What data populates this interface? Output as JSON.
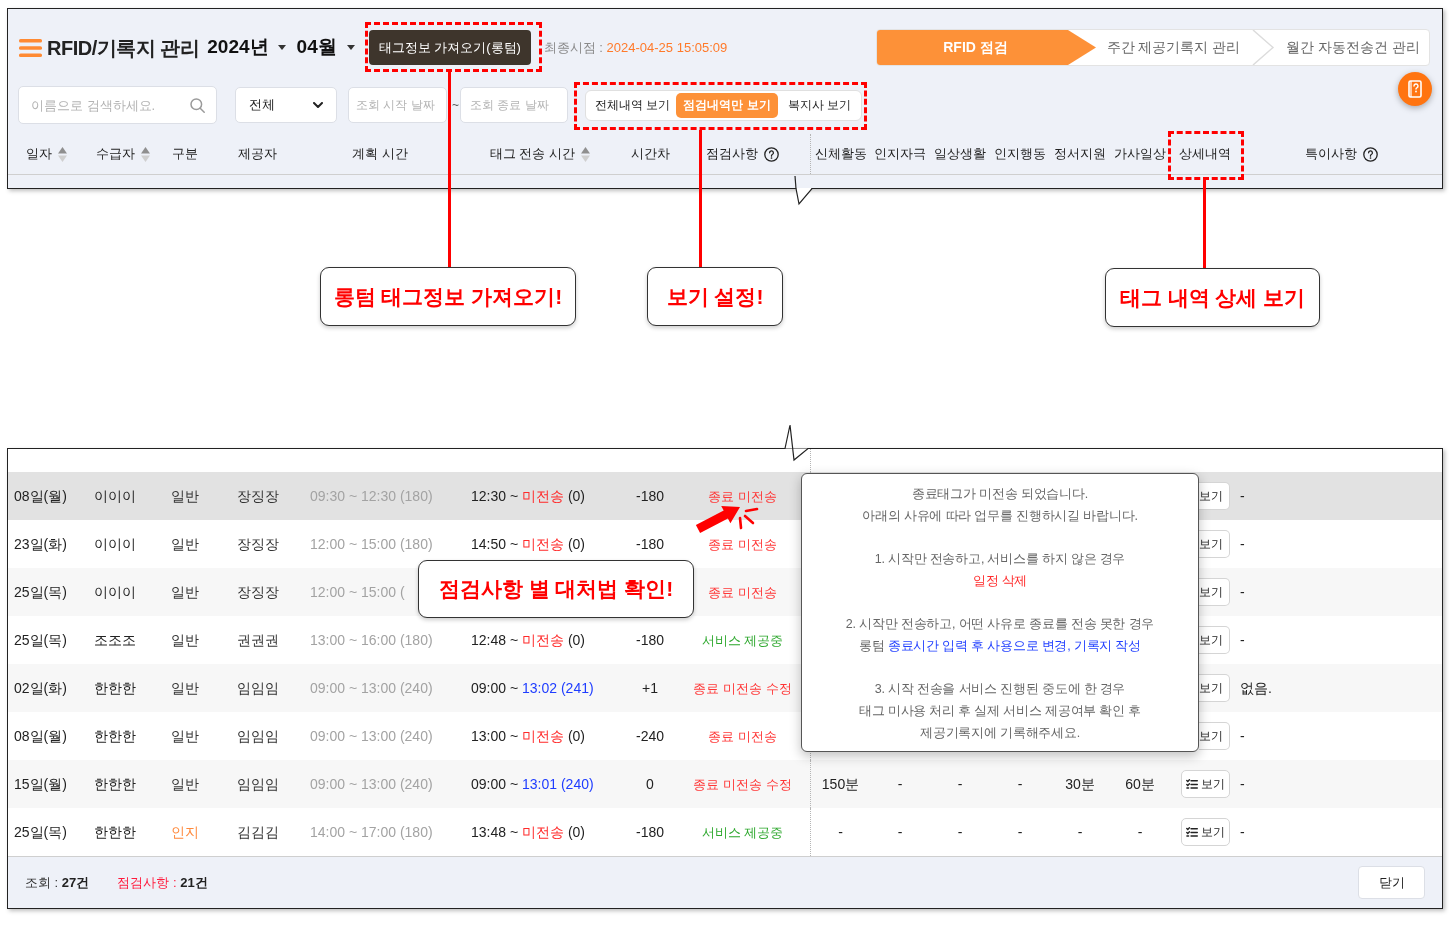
{
  "header": {
    "title": "RFID/기록지 관리",
    "year": "2024년",
    "month": "04월",
    "fetch_button": "태그정보 가져오기(롱텀)",
    "last_sync": {
      "label": "최종시점 :",
      "value": "2024-04-25 15:05:09"
    }
  },
  "steps": [
    {
      "label": "RFID 점검",
      "selected": true
    },
    {
      "label": "주간 제공기록지 관리",
      "selected": false
    },
    {
      "label": "월간 자동전송건 관리",
      "selected": false
    }
  ],
  "filters": {
    "search": {
      "placeholder": "이름으로 검색하세요."
    },
    "category": {
      "value": "전체"
    },
    "start_date": {
      "placeholder": "조회 시작 날짜"
    },
    "separator": "~",
    "end_date": {
      "placeholder": "조회 종료 날짜"
    }
  },
  "view_modes": [
    {
      "label": "전체내역 보기",
      "selected": false
    },
    {
      "label": "점검내역만 보기",
      "selected": true
    },
    {
      "label": "복지사 보기",
      "selected": false
    }
  ],
  "table": {
    "columns": [
      {
        "label": "일자",
        "kind": "sort"
      },
      {
        "label": "수급자",
        "kind": "sort"
      },
      {
        "label": "구분",
        "kind": "plain"
      },
      {
        "label": "제공자",
        "kind": "plain"
      },
      {
        "label": "계획 시간",
        "kind": "plain"
      },
      {
        "label": "태그 전송 시간",
        "kind": "sort"
      },
      {
        "label": "시간차",
        "kind": "plain"
      },
      {
        "label": "점검사항",
        "kind": "help"
      },
      {
        "label": "신체활동",
        "kind": "plain"
      },
      {
        "label": "인지자극",
        "kind": "plain"
      },
      {
        "label": "일상생활",
        "kind": "plain"
      },
      {
        "label": "인지행동",
        "kind": "plain"
      },
      {
        "label": "정서지원",
        "kind": "plain"
      },
      {
        "label": "가사일상",
        "kind": "plain"
      },
      {
        "label": "상세내역",
        "kind": "plain"
      },
      {
        "label": "특이사항",
        "kind": "help"
      }
    ],
    "rows": [
      {
        "date": "08일(월)",
        "recipient": "이이이",
        "category": {
          "label": "일반",
          "kind": "general"
        },
        "provider": "장징장",
        "planned": "09:30 ~ 12:30 (180)",
        "sent": {
          "start": "12:30 ~",
          "end": "미전송",
          "minutes": "(0)",
          "delivered": false
        },
        "diff": "-180",
        "check": {
          "label": "종료 미전송",
          "kind": "alert"
        },
        "detail": {
          "label": "보기",
          "clipped": true
        },
        "note": "-",
        "selected": true
      },
      {
        "date": "23일(화)",
        "recipient": "이이이",
        "category": {
          "label": "일반",
          "kind": "general"
        },
        "provider": "장징장",
        "planned": "12:00 ~ 15:00 (180)",
        "sent": {
          "start": "14:50 ~",
          "end": "미전송",
          "minutes": "(0)",
          "delivered": false
        },
        "diff": "-180",
        "check": {
          "label": "종료 미전송",
          "kind": "alert"
        },
        "detail": {
          "label": "보기",
          "clipped": true
        },
        "note": "-",
        "selected": false
      },
      {
        "date": "25일(목)",
        "recipient": "이이이",
        "category": {
          "label": "일반",
          "kind": "general"
        },
        "provider": "장징장",
        "planned": "12:00 ~ 15:00 (",
        "check": {
          "label": "종료 미전송",
          "kind": "alert"
        },
        "detail": {
          "label": "보기",
          "clipped": true
        },
        "note": "-",
        "selected": false
      },
      {
        "date": "25일(목)",
        "recipient": "조조조",
        "category": {
          "label": "일반",
          "kind": "general"
        },
        "provider": "권권권",
        "planned": "13:00 ~ 16:00 (180)",
        "sent": {
          "start": "12:48 ~",
          "end": "미전송",
          "minutes": "(0)",
          "delivered": false
        },
        "diff": "-180",
        "check": {
          "label": "서비스 제공중",
          "kind": "ok"
        },
        "detail": {
          "label": "보기",
          "clipped": true
        },
        "note": "-",
        "selected": false
      },
      {
        "date": "02일(화)",
        "recipient": "한한한",
        "category": {
          "label": "일반",
          "kind": "general"
        },
        "provider": "임임임",
        "planned": "09:00 ~ 13:00 (240)",
        "sent": {
          "start": "09:00 ~",
          "end": "13:02",
          "minutes": "(241)",
          "delivered": true
        },
        "diff": "+1",
        "check": {
          "label": "종료 미전송 수정",
          "kind": "alert"
        },
        "detail": {
          "label": "보기",
          "clipped": true
        },
        "note": "없음.",
        "selected": false
      },
      {
        "date": "08일(월)",
        "recipient": "한한한",
        "category": {
          "label": "일반",
          "kind": "general"
        },
        "provider": "임임임",
        "planned": "09:00 ~ 13:00 (240)",
        "sent": {
          "start": "13:00 ~",
          "end": "미전송",
          "minutes": "(0)",
          "delivered": false
        },
        "diff": "-240",
        "check": {
          "label": "종료 미전송",
          "kind": "alert"
        },
        "detail": {
          "label": "보기",
          "clipped": true
        },
        "note": "-",
        "selected": false
      },
      {
        "date": "15일(월)",
        "recipient": "한한한",
        "category": {
          "label": "일반",
          "kind": "general"
        },
        "provider": "임임임",
        "planned": "09:00 ~ 13:00 (240)",
        "sent": {
          "start": "09:00 ~",
          "end": "13:01",
          "minutes": "(240)",
          "delivered": true
        },
        "diff": "0",
        "check": {
          "label": "종료 미전송 수정",
          "kind": "alert"
        },
        "activities": [
          "150분",
          "-",
          "-",
          "-",
          "30분",
          "60분"
        ],
        "detail": {
          "label": "보기",
          "clipped": false
        },
        "note": "-",
        "selected": false
      },
      {
        "date": "25일(목)",
        "recipient": "한한한",
        "category": {
          "label": "인지",
          "kind": "cognitive"
        },
        "provider": "김김김",
        "planned": "14:00 ~ 17:00 (180)",
        "sent": {
          "start": "13:48 ~",
          "end": "미전송",
          "minutes": "(0)",
          "delivered": false
        },
        "diff": "-180",
        "check": {
          "label": "서비스 제공중",
          "kind": "ok"
        },
        "activities": [
          "-",
          "-",
          "-",
          "-",
          "-",
          "-"
        ],
        "detail": {
          "label": "보기",
          "clipped": false
        },
        "note": "-",
        "selected": false
      }
    ]
  },
  "footer": {
    "stats": [
      {
        "label": "조회 :",
        "value": "27건",
        "kind": "plain"
      },
      {
        "label": "점검사항 :",
        "value": "21건",
        "kind": "alert"
      }
    ],
    "close_button": "닫기"
  },
  "popover": {
    "paragraphs": [
      {
        "lines": [
          [
            {
              "text": "종료태그가 미전송 되었습니다.",
              "kind": "plain"
            }
          ],
          [
            {
              "text": "아래의 사유에 따라 업무를 진행하시길 바랍니다.",
              "kind": "plain"
            }
          ]
        ]
      },
      {
        "lines": [
          [
            {
              "text": "1. 시작만 전송하고, 서비스를 하지 않은 경우",
              "kind": "plain"
            }
          ],
          [
            {
              "text": "일정 삭제",
              "kind": "danger"
            }
          ]
        ]
      },
      {
        "lines": [
          [
            {
              "text": "2. 시작만 전송하고, 어떤 사유로 종료를 전송 못한 경우",
              "kind": "plain"
            }
          ],
          [
            {
              "text": "롱텀 ",
              "kind": "plain"
            },
            {
              "text": "종료시간 입력 후 사용으로 변경, 기록지 작성",
              "kind": "info"
            }
          ]
        ]
      },
      {
        "lines": [
          [
            {
              "text": "3. 시작 전송을 서비스 진행된 중도에 한 경우",
              "kind": "plain"
            }
          ],
          [
            {
              "text": "태그 미사용 처리 후 실제 서비스 제공여부 확인 후",
              "kind": "plain"
            }
          ],
          [
            {
              "text": "제공기록지에 기록해주세요.",
              "kind": "plain"
            }
          ]
        ]
      }
    ]
  },
  "callouts": [
    {
      "text": "롱텀 태그정보 가져오기!"
    },
    {
      "text": "보기 설정!"
    },
    {
      "text": "태그 내역 상세 보기"
    },
    {
      "text": "점검사항 별 대처법 확인!"
    }
  ]
}
